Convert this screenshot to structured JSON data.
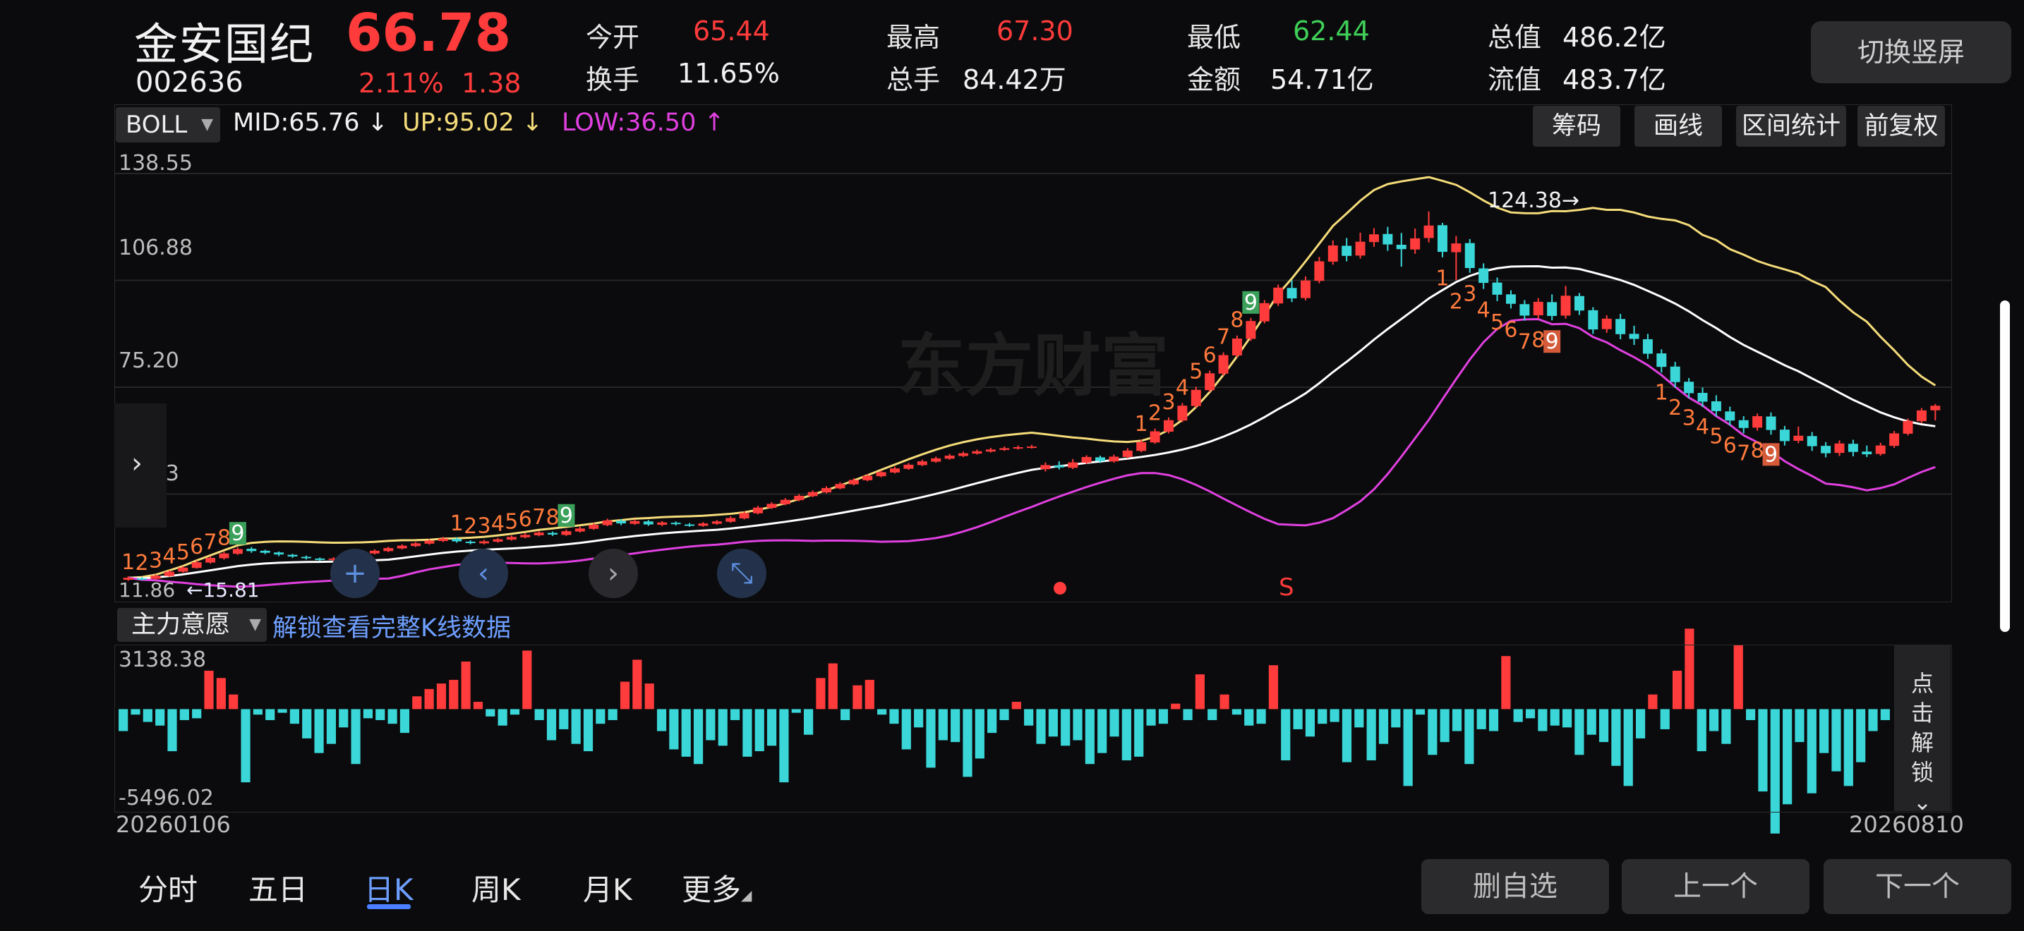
{
  "header": {
    "name": "金安国纪",
    "price": "66.78",
    "code": "002636",
    "change_pct": "2.11%",
    "change_amt": "1.38",
    "stats": [
      {
        "label": "今开",
        "value": "65.44",
        "color": "red"
      },
      {
        "label": "换手",
        "value": "11.65%",
        "color": "white"
      },
      {
        "label": "最高",
        "value": "67.30",
        "color": "red"
      },
      {
        "label": "总手",
        "value": "84.42万",
        "color": "white"
      },
      {
        "label": "最低",
        "value": "62.44",
        "color": "green"
      },
      {
        "label": "金额",
        "value": "54.71亿",
        "color": "white"
      },
      {
        "label": "总值",
        "value": "486.2亿",
        "color": "white"
      },
      {
        "label": "流值",
        "value": "483.7亿",
        "color": "white"
      }
    ],
    "switch_label": "切换竖屏"
  },
  "indicator": {
    "select": "BOLL",
    "mid": "MID:65.76",
    "mid_arrow": "↓",
    "up": "UP:95.02",
    "up_arrow": "↓",
    "low": "LOW:36.50",
    "low_arrow": "↑"
  },
  "tools": [
    "筹码",
    "画线",
    "区间统计",
    "前复权"
  ],
  "y_axis": [
    "138.55",
    "106.88",
    "75.20",
    "43.53"
  ],
  "min_label": "11.86",
  "min_label_marker": "←15.81",
  "max_marker": "124.38→",
  "watermark": "东方财富",
  "signal_s": "S",
  "sub": {
    "select": "主力意愿",
    "unlock_link": "解锁查看完整K线数据",
    "max": "3138.38",
    "min": "-5496.02",
    "unlock_side": [
      "点",
      "击",
      "解",
      "锁",
      "⌄"
    ]
  },
  "dates": {
    "start": "20260106",
    "end": "20260810"
  },
  "tabs": [
    "分时",
    "五日",
    "日K",
    "周K",
    "月K",
    "更多"
  ],
  "buttons": {
    "remove": "删自选",
    "prev": "上一个",
    "next": "下一个"
  },
  "nav_icons": [
    "+",
    "‹",
    "›",
    "⤡"
  ],
  "colors": {
    "up": "#ff3b3b",
    "down": "#3ad6d8",
    "mid": "#ffffff",
    "upper": "#f5dc7a",
    "lower": "#e040e0",
    "accent": "#4a7fff"
  },
  "seq_labels": {
    "a": [
      "1",
      "2",
      "3",
      "4",
      "5",
      "6",
      "7",
      "8",
      "9"
    ],
    "b": [
      "1",
      "2",
      "3",
      "4",
      "5",
      "6",
      "7",
      "8",
      "9"
    ],
    "c": [
      "1",
      "2",
      "3",
      "4",
      "5",
      "6",
      "7",
      "8",
      "9"
    ],
    "d": [
      "1",
      "2",
      "3",
      "4",
      "5",
      "6",
      "7",
      "8",
      "9"
    ],
    "e": [
      "1",
      "2",
      "3",
      "4",
      "5",
      "6",
      "7",
      "8",
      "9"
    ]
  },
  "chart_data": {
    "type": "candlestick",
    "ylim": [
      11.86,
      138.55
    ],
    "boll_mid_last": 65.76,
    "boll_up_last": 95.02,
    "boll_low_last": 36.5,
    "high_marker": 124.38,
    "low_marker": 15.81,
    "sub_range": [
      -5496.02,
      3138.38
    ],
    "sub_values": [
      -1200,
      -300,
      -700,
      -900,
      -2300,
      -600,
      -500,
      2100,
      1700,
      800,
      -4000,
      -300,
      -600,
      -200,
      -800,
      -1600,
      -2400,
      -1900,
      -1000,
      -3000,
      -500,
      -600,
      -800,
      -1300,
      700,
      1100,
      1400,
      1600,
      2600,
      400,
      -400,
      -900,
      -300,
      3200,
      -600,
      -1700,
      -1100,
      -1900,
      -2300,
      -800,
      -600,
      1500,
      2700,
      1400,
      -1200,
      -2200,
      -2600,
      -3000,
      -1700,
      -2000,
      -600,
      -2600,
      -2300,
      -2000,
      -4000,
      -200,
      -1400,
      1700,
      2500,
      -600,
      1300,
      1600,
      -300,
      -800,
      -2200,
      -1000,
      -3200,
      -1700,
      -1800,
      -3700,
      -2700,
      -1300,
      -600,
      400,
      -900,
      -1900,
      -1500,
      -2000,
      -1700,
      -3000,
      -2400,
      -1500,
      -2800,
      -2600,
      -900,
      -800,
      300,
      -600,
      1900,
      -600,
      800,
      -300,
      -900,
      -800,
      2400,
      -2800,
      -1100,
      -1500,
      -800,
      -700,
      -2900,
      -1000,
      -2800,
      -1900,
      -1000,
      -4200,
      -300,
      -2500,
      -1800,
      -1200,
      -3000,
      -1100,
      -1200,
      2900,
      -700,
      -500,
      -1200,
      -900,
      -1000,
      -2500,
      -1400,
      -1800,
      -3100,
      -4200,
      -1600,
      800,
      -1100,
      2100,
      4400,
      -2300,
      -1200,
      -1900,
      3500,
      -600,
      -4500,
      -6800,
      -5200,
      -1800,
      -4600,
      -2400,
      -3400,
      -4200,
      -2900,
      -1200,
      -600
    ],
    "candles": [
      {
        "o": 15.2,
        "c": 15.8,
        "h": 16.2,
        "l": 14.9
      },
      {
        "o": 15.6,
        "c": 15.4,
        "h": 16.0,
        "l": 15.1
      },
      {
        "o": 15.5,
        "c": 16.4,
        "h": 16.8,
        "l": 15.2
      },
      {
        "o": 16.3,
        "c": 17.6,
        "h": 18.0,
        "l": 16.1
      },
      {
        "o": 17.6,
        "c": 18.8,
        "h": 19.2,
        "l": 17.3
      },
      {
        "o": 18.7,
        "c": 20.4,
        "h": 20.9,
        "l": 18.5
      },
      {
        "o": 20.3,
        "c": 21.7,
        "h": 22.2,
        "l": 20.0
      },
      {
        "o": 21.6,
        "c": 23.0,
        "h": 23.5,
        "l": 21.2
      },
      {
        "o": 22.9,
        "c": 24.3,
        "h": 24.8,
        "l": 22.6
      },
      {
        "o": 24.4,
        "c": 23.7,
        "h": 24.9,
        "l": 23.2
      },
      {
        "o": 23.8,
        "c": 23.2,
        "h": 24.1,
        "l": 22.8
      },
      {
        "o": 23.3,
        "c": 22.7,
        "h": 23.6,
        "l": 22.2
      },
      {
        "o": 22.6,
        "c": 22.1,
        "h": 22.9,
        "l": 21.7
      },
      {
        "o": 22.0,
        "c": 21.6,
        "h": 22.4,
        "l": 21.2
      },
      {
        "o": 21.5,
        "c": 21.1,
        "h": 21.8,
        "l": 20.8
      },
      {
        "o": 21.1,
        "c": 21.5,
        "h": 21.9,
        "l": 20.7
      },
      {
        "o": 21.5,
        "c": 22.4,
        "h": 22.8,
        "l": 21.2
      },
      {
        "o": 22.3,
        "c": 23.1,
        "h": 23.5,
        "l": 22.0
      },
      {
        "o": 23.0,
        "c": 23.8,
        "h": 24.2,
        "l": 22.7
      },
      {
        "o": 23.7,
        "c": 24.6,
        "h": 25.0,
        "l": 23.4
      },
      {
        "o": 24.5,
        "c": 25.3,
        "h": 25.7,
        "l": 24.2
      },
      {
        "o": 25.2,
        "c": 26.0,
        "h": 26.4,
        "l": 24.9
      },
      {
        "o": 25.9,
        "c": 26.8,
        "h": 27.2,
        "l": 25.6
      },
      {
        "o": 26.7,
        "c": 27.4,
        "h": 27.9,
        "l": 26.4
      },
      {
        "o": 27.3,
        "c": 26.6,
        "h": 27.8,
        "l": 26.2
      },
      {
        "o": 26.5,
        "c": 26.1,
        "h": 26.9,
        "l": 25.7
      },
      {
        "o": 26.0,
        "c": 26.6,
        "h": 27.0,
        "l": 25.7
      },
      {
        "o": 26.5,
        "c": 27.2,
        "h": 27.6,
        "l": 26.2
      },
      {
        "o": 27.1,
        "c": 27.9,
        "h": 28.3,
        "l": 26.8
      },
      {
        "o": 27.8,
        "c": 28.5,
        "h": 29.0,
        "l": 27.5
      },
      {
        "o": 28.4,
        "c": 29.2,
        "h": 29.6,
        "l": 28.1
      },
      {
        "o": 29.1,
        "c": 28.6,
        "h": 29.5,
        "l": 28.2
      },
      {
        "o": 28.5,
        "c": 29.6,
        "h": 30.1,
        "l": 28.2
      },
      {
        "o": 29.5,
        "c": 30.4,
        "h": 30.9,
        "l": 29.2
      },
      {
        "o": 30.3,
        "c": 31.5,
        "h": 32.0,
        "l": 30.0
      },
      {
        "o": 31.4,
        "c": 32.8,
        "h": 33.3,
        "l": 31.1
      },
      {
        "o": 32.7,
        "c": 31.9,
        "h": 33.2,
        "l": 31.4
      },
      {
        "o": 31.8,
        "c": 32.6,
        "h": 33.1,
        "l": 31.5
      },
      {
        "o": 32.5,
        "c": 31.6,
        "h": 32.9,
        "l": 31.2
      },
      {
        "o": 31.5,
        "c": 32.2,
        "h": 32.6,
        "l": 31.1
      },
      {
        "o": 32.1,
        "c": 31.7,
        "h": 32.5,
        "l": 31.3
      },
      {
        "o": 31.6,
        "c": 31.3,
        "h": 32.0,
        "l": 30.9
      },
      {
        "o": 31.2,
        "c": 31.9,
        "h": 32.3,
        "l": 30.9
      },
      {
        "o": 31.8,
        "c": 32.5,
        "h": 32.9,
        "l": 31.5
      },
      {
        "o": 32.4,
        "c": 33.5,
        "h": 34.0,
        "l": 32.1
      },
      {
        "o": 33.4,
        "c": 35.0,
        "h": 35.5,
        "l": 33.1
      },
      {
        "o": 34.9,
        "c": 36.6,
        "h": 37.1,
        "l": 34.6
      },
      {
        "o": 36.5,
        "c": 37.7,
        "h": 38.2,
        "l": 36.2
      },
      {
        "o": 37.6,
        "c": 38.9,
        "h": 39.4,
        "l": 37.3
      },
      {
        "o": 38.8,
        "c": 40.1,
        "h": 40.6,
        "l": 38.5
      },
      {
        "o": 40.0,
        "c": 41.2,
        "h": 41.7,
        "l": 39.7
      },
      {
        "o": 41.1,
        "c": 42.4,
        "h": 42.9,
        "l": 40.8
      },
      {
        "o": 42.3,
        "c": 43.6,
        "h": 44.1,
        "l": 42.0
      },
      {
        "o": 43.5,
        "c": 44.8,
        "h": 45.3,
        "l": 43.2
      },
      {
        "o": 44.7,
        "c": 46.0,
        "h": 46.5,
        "l": 44.4
      },
      {
        "o": 45.9,
        "c": 47.1,
        "h": 47.6,
        "l": 45.6
      },
      {
        "o": 47.0,
        "c": 48.2,
        "h": 48.7,
        "l": 46.7
      },
      {
        "o": 48.1,
        "c": 49.3,
        "h": 49.8,
        "l": 47.8
      },
      {
        "o": 49.2,
        "c": 50.3,
        "h": 50.8,
        "l": 48.9
      },
      {
        "o": 50.2,
        "c": 51.2,
        "h": 51.7,
        "l": 49.9
      },
      {
        "o": 51.1,
        "c": 52.0,
        "h": 52.5,
        "l": 50.8
      },
      {
        "o": 51.9,
        "c": 52.7,
        "h": 53.2,
        "l": 51.6
      },
      {
        "o": 52.6,
        "c": 53.3,
        "h": 53.8,
        "l": 52.3
      },
      {
        "o": 53.2,
        "c": 53.8,
        "h": 54.3,
        "l": 52.9
      },
      {
        "o": 53.7,
        "c": 54.2,
        "h": 54.7,
        "l": 53.4
      },
      {
        "o": 54.1,
        "c": 54.5,
        "h": 55.0,
        "l": 53.8
      },
      {
        "o": 54.4,
        "c": 54.7,
        "h": 55.2,
        "l": 54.1
      },
      {
        "o": 48.0,
        "c": 49.2,
        "h": 50.0,
        "l": 47.3
      },
      {
        "o": 49.1,
        "c": 48.5,
        "h": 50.3,
        "l": 47.9
      },
      {
        "o": 48.4,
        "c": 50.0,
        "h": 51.0,
        "l": 48.0
      },
      {
        "o": 49.9,
        "c": 51.6,
        "h": 52.1,
        "l": 49.5
      },
      {
        "o": 51.5,
        "c": 50.4,
        "h": 52.0,
        "l": 49.8
      },
      {
        "o": 50.3,
        "c": 51.7,
        "h": 52.3,
        "l": 49.9
      },
      {
        "o": 51.6,
        "c": 53.5,
        "h": 54.2,
        "l": 51.2
      },
      {
        "o": 53.4,
        "c": 56.0,
        "h": 56.8,
        "l": 53.0
      },
      {
        "o": 55.9,
        "c": 59.2,
        "h": 60.0,
        "l": 55.5
      },
      {
        "o": 59.1,
        "c": 62.5,
        "h": 63.3,
        "l": 58.6
      },
      {
        "o": 62.4,
        "c": 66.8,
        "h": 67.6,
        "l": 61.9
      },
      {
        "o": 66.7,
        "c": 71.5,
        "h": 72.4,
        "l": 66.2
      },
      {
        "o": 71.4,
        "c": 76.4,
        "h": 77.2,
        "l": 70.9
      },
      {
        "o": 76.3,
        "c": 81.8,
        "h": 82.6,
        "l": 75.7
      },
      {
        "o": 81.7,
        "c": 86.7,
        "h": 87.6,
        "l": 81.1
      },
      {
        "o": 86.6,
        "c": 91.9,
        "h": 92.8,
        "l": 86.0
      },
      {
        "o": 91.8,
        "c": 97.2,
        "h": 98.1,
        "l": 91.2
      },
      {
        "o": 97.1,
        "c": 101.8,
        "h": 102.7,
        "l": 96.4
      },
      {
        "o": 101.7,
        "c": 98.6,
        "h": 104.0,
        "l": 97.5
      },
      {
        "o": 98.7,
        "c": 103.9,
        "h": 105.1,
        "l": 98.0
      },
      {
        "o": 103.8,
        "c": 109.6,
        "h": 110.9,
        "l": 103.1
      },
      {
        "o": 109.5,
        "c": 114.3,
        "h": 115.8,
        "l": 108.6
      },
      {
        "o": 114.2,
        "c": 111.2,
        "h": 116.5,
        "l": 109.6
      },
      {
        "o": 111.3,
        "c": 115.4,
        "h": 118.1,
        "l": 110.4
      },
      {
        "o": 115.3,
        "c": 117.6,
        "h": 119.4,
        "l": 113.9
      },
      {
        "o": 117.7,
        "c": 114.6,
        "h": 119.8,
        "l": 112.7
      },
      {
        "o": 114.5,
        "c": 113.2,
        "h": 118.0,
        "l": 108.0
      },
      {
        "o": 113.1,
        "c": 116.4,
        "h": 119.3,
        "l": 111.8
      },
      {
        "o": 116.5,
        "c": 120.2,
        "h": 124.38,
        "l": 115.2
      },
      {
        "o": 120.3,
        "c": 112.4,
        "h": 121.0,
        "l": 110.8
      },
      {
        "o": 112.3,
        "c": 114.9,
        "h": 117.1,
        "l": 104.0
      },
      {
        "o": 115.0,
        "c": 107.6,
        "h": 116.2,
        "l": 106.2
      },
      {
        "o": 107.5,
        "c": 103.2,
        "h": 109.0,
        "l": 101.4
      },
      {
        "o": 103.3,
        "c": 99.7,
        "h": 104.8,
        "l": 97.8
      },
      {
        "o": 99.8,
        "c": 97.0,
        "h": 101.0,
        "l": 95.6
      },
      {
        "o": 96.9,
        "c": 93.5,
        "h": 98.1,
        "l": 92.0
      },
      {
        "o": 93.6,
        "c": 97.6,
        "h": 98.7,
        "l": 92.6
      },
      {
        "o": 97.5,
        "c": 93.4,
        "h": 99.8,
        "l": 92.1
      },
      {
        "o": 93.5,
        "c": 99.4,
        "h": 102.3,
        "l": 92.6
      },
      {
        "o": 99.3,
        "c": 95.0,
        "h": 100.2,
        "l": 93.7
      },
      {
        "o": 95.1,
        "c": 89.4,
        "h": 96.0,
        "l": 88.1
      },
      {
        "o": 89.5,
        "c": 92.6,
        "h": 93.6,
        "l": 88.4
      },
      {
        "o": 92.5,
        "c": 88.0,
        "h": 94.0,
        "l": 86.5
      },
      {
        "o": 88.1,
        "c": 86.6,
        "h": 90.5,
        "l": 84.8
      },
      {
        "o": 86.5,
        "c": 82.2,
        "h": 88.1,
        "l": 80.7
      },
      {
        "o": 82.3,
        "c": 78.3,
        "h": 83.5,
        "l": 76.6
      },
      {
        "o": 78.4,
        "c": 73.8,
        "h": 79.8,
        "l": 72.1
      },
      {
        "o": 73.9,
        "c": 70.5,
        "h": 75.0,
        "l": 69.0
      },
      {
        "o": 70.6,
        "c": 68.0,
        "h": 72.2,
        "l": 66.4
      },
      {
        "o": 68.1,
        "c": 65.2,
        "h": 69.9,
        "l": 63.6
      },
      {
        "o": 65.1,
        "c": 62.4,
        "h": 66.5,
        "l": 60.9
      },
      {
        "o": 62.5,
        "c": 60.2,
        "h": 63.7,
        "l": 58.6
      },
      {
        "o": 60.3,
        "c": 63.7,
        "h": 64.5,
        "l": 59.4
      },
      {
        "o": 63.6,
        "c": 59.6,
        "h": 64.8,
        "l": 58.2
      },
      {
        "o": 59.7,
        "c": 56.3,
        "h": 60.8,
        "l": 55.0
      },
      {
        "o": 56.4,
        "c": 57.9,
        "h": 60.6,
        "l": 55.7
      },
      {
        "o": 57.8,
        "c": 54.8,
        "h": 59.0,
        "l": 53.4
      },
      {
        "o": 54.9,
        "c": 52.7,
        "h": 56.0,
        "l": 51.5
      },
      {
        "o": 52.8,
        "c": 55.6,
        "h": 56.5,
        "l": 51.9
      },
      {
        "o": 55.5,
        "c": 53.1,
        "h": 56.7,
        "l": 51.8
      },
      {
        "o": 53.2,
        "c": 52.4,
        "h": 55.0,
        "l": 51.6
      },
      {
        "o": 52.5,
        "c": 55.0,
        "h": 55.8,
        "l": 52.0
      },
      {
        "o": 54.9,
        "c": 58.6,
        "h": 59.3,
        "l": 54.3
      },
      {
        "o": 58.5,
        "c": 62.3,
        "h": 63.0,
        "l": 58.0
      },
      {
        "o": 62.2,
        "c": 65.4,
        "h": 66.1,
        "l": 61.6
      },
      {
        "o": 65.44,
        "c": 66.78,
        "h": 67.3,
        "l": 62.44
      }
    ]
  }
}
